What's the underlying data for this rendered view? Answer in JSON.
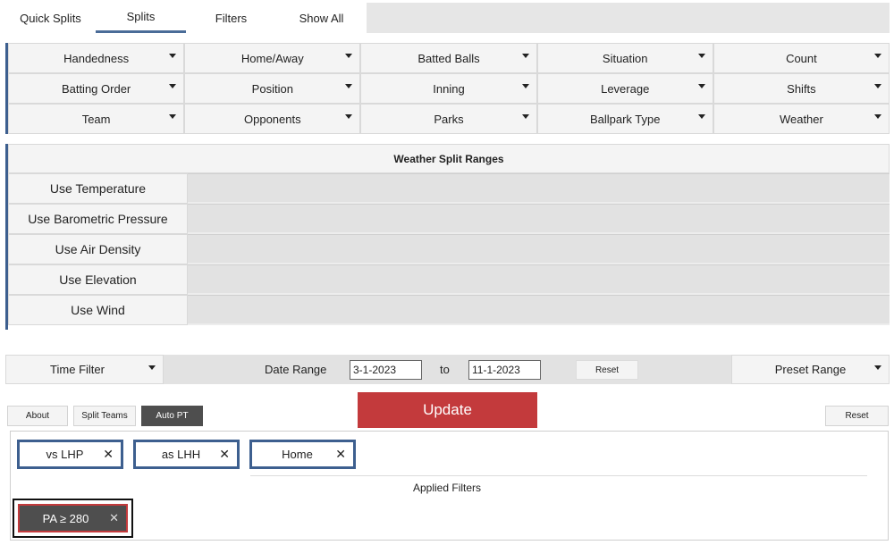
{
  "tabs": [
    "Quick Splits",
    "Splits",
    "Filters",
    "Show All"
  ],
  "active_tab": "Splits",
  "dropdowns": [
    [
      "Handedness",
      "Home/Away",
      "Batted Balls",
      "Situation",
      "Count"
    ],
    [
      "Batting Order",
      "Position",
      "Inning",
      "Leverage",
      "Shifts"
    ],
    [
      "Team",
      "Opponents",
      "Parks",
      "Ballpark Type",
      "Weather"
    ]
  ],
  "weather": {
    "title": "Weather Split Ranges",
    "rows": [
      "Use Temperature",
      "Use Barometric Pressure",
      "Use Air Density",
      "Use Elevation",
      "Use Wind"
    ]
  },
  "timebar": {
    "time_filter_label": "Time Filter",
    "date_range_label": "Date Range",
    "start_date": "3-1-2023",
    "to_label": "to",
    "end_date": "11-1-2023",
    "reset_label": "Reset",
    "preset_label": "Preset Range"
  },
  "buttons": {
    "about": "About",
    "split_teams": "Split Teams",
    "auto_pt": "Auto PT",
    "update": "Update",
    "reset": "Reset"
  },
  "applied": {
    "title": "Applied Filters",
    "chips": [
      "vs LHP",
      "as LHH",
      "Home"
    ],
    "pa_chip": "PA ≥ 280",
    "close_glyph": "✕"
  },
  "colors": {
    "accent_blue": "#3d5f8f",
    "update_red": "#c33a3c",
    "dark_button": "#4e4e4e"
  }
}
